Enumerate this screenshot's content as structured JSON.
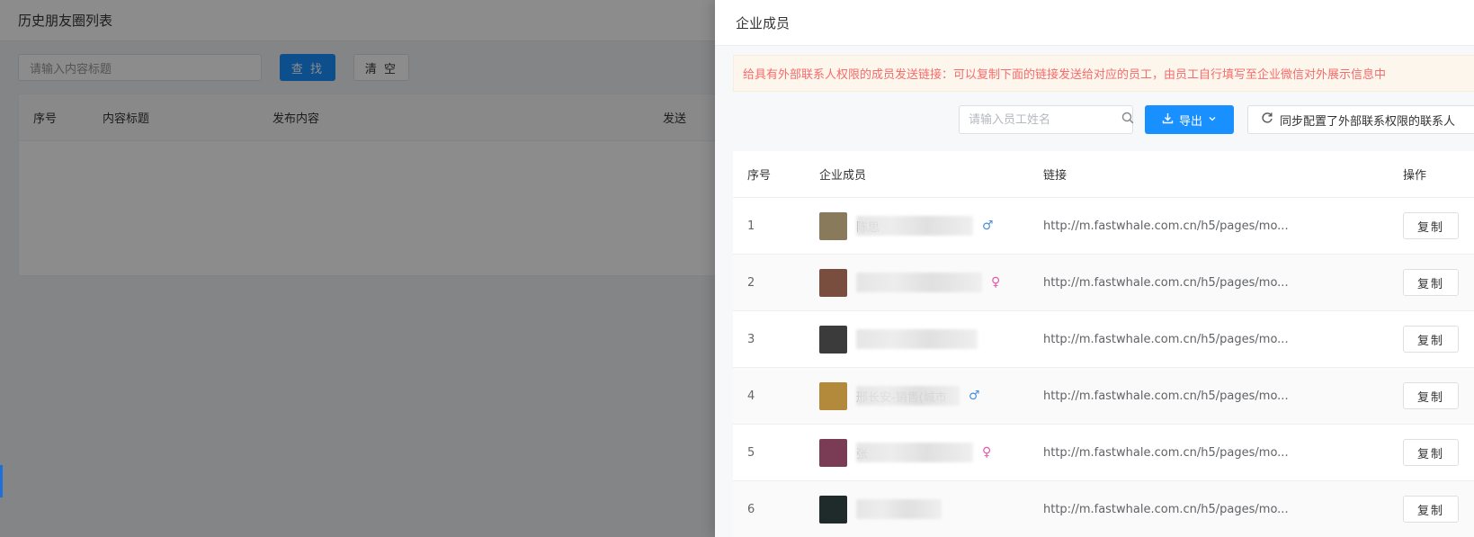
{
  "background": {
    "title": "历史朋友圈列表",
    "search_placeholder": "请输入内容标题",
    "find_label": "查 找",
    "clear_label": "清 空",
    "columns": [
      "序号",
      "内容标题",
      "发布内容",
      "发送"
    ]
  },
  "drawer": {
    "title": "企业成员",
    "alert": "给具有外部联系人权限的成员发送链接：可以复制下面的链接发送给对应的员工，由员工自行填写至企业微信对外展示信息中",
    "search_placeholder": "请输入员工姓名",
    "export_label": "导出",
    "sync_label": "同步配置了外部联系权限的联系人",
    "columns": {
      "index": "序号",
      "member": "企业成员",
      "link": "链接",
      "op": "操作"
    },
    "rows": [
      {
        "index": "1",
        "name": "陈思",
        "gender_icon": "male-icon",
        "link": "http://m.fastwhale.com.cn/h5/pages/mo...",
        "copy": "复制",
        "avatar_color": "#8a7a5c"
      },
      {
        "index": "2",
        "name": "",
        "gender_icon": "female-icon",
        "link": "http://m.fastwhale.com.cn/h5/pages/mo...",
        "copy": "复制",
        "avatar_color": "#7a4e3e"
      },
      {
        "index": "3",
        "name": "",
        "gender_icon": "",
        "link": "http://m.fastwhale.com.cn/h5/pages/mo...",
        "copy": "复制",
        "avatar_color": "#3b3b3b"
      },
      {
        "index": "4",
        "name": "邢长安-销售(城市",
        "gender_icon": "male-icon",
        "link": "http://m.fastwhale.com.cn/h5/pages/mo...",
        "copy": "复制",
        "avatar_color": "#b38a3c"
      },
      {
        "index": "5",
        "name": "张",
        "gender_icon": "female-icon",
        "link": "http://m.fastwhale.com.cn/h5/pages/mo...",
        "copy": "复制",
        "avatar_color": "#7a3b55"
      },
      {
        "index": "6",
        "name": "",
        "gender_icon": "",
        "link": "http://m.fastwhale.com.cn/h5/pages/mo...",
        "copy": "复制",
        "avatar_color": "#1f2a2a"
      }
    ]
  },
  "colors": {
    "primary": "#1890ff",
    "alert_text": "#f56c6c",
    "alert_bg": "#fdf6ec",
    "male": "#4a90d9",
    "female": "#e25aa8"
  }
}
